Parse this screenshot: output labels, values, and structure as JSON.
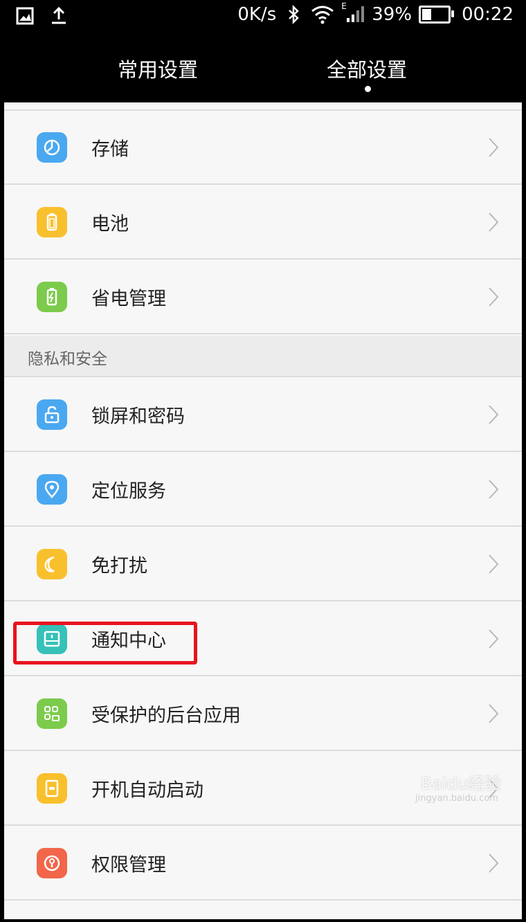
{
  "status_bar": {
    "speed": "0K/s",
    "battery_percent": "39%",
    "time": "00:22",
    "signal_type": "E",
    "battery_level": 0.39
  },
  "tabs": {
    "common_label": "常用设置",
    "all_label": "全部设置",
    "active": "all"
  },
  "rows_top": [
    {
      "label": "存储",
      "icon": "storage-icon",
      "color": "#4aa8f0"
    },
    {
      "label": "电池",
      "icon": "battery-icon",
      "color": "#f9c02d"
    },
    {
      "label": "省电管理",
      "icon": "power-saving-icon",
      "color": "#7ccb4c"
    }
  ],
  "section_privacy": {
    "title": "隐私和安全"
  },
  "rows_privacy": [
    {
      "label": "锁屏和密码",
      "icon": "lock-icon",
      "color": "#4aa8f0"
    },
    {
      "label": "定位服务",
      "icon": "location-icon",
      "color": "#4aa8f0"
    },
    {
      "label": "免打扰",
      "icon": "moon-icon",
      "color": "#f9c02d"
    },
    {
      "label": "通知中心",
      "icon": "notification-icon",
      "color": "#36c1b9"
    },
    {
      "label": "受保护的后台应用",
      "icon": "protected-apps-icon",
      "color": "#7ccb4c"
    },
    {
      "label": "开机自动启动",
      "icon": "autostart-icon",
      "color": "#f9c02d"
    },
    {
      "label": "权限管理",
      "icon": "permission-icon",
      "color": "#f2664a"
    }
  ],
  "watermark": {
    "text": "Baidu经验",
    "sub": "jingyan.baidu.com"
  }
}
